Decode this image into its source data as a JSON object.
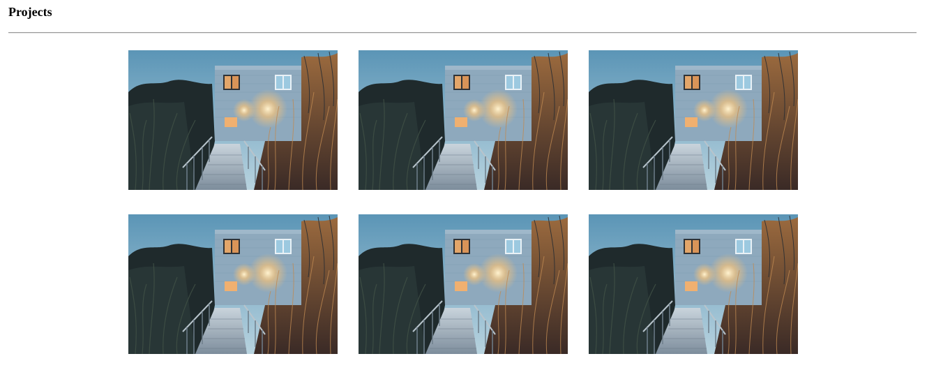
{
  "page": {
    "title": "Projects"
  },
  "projects": [
    {
      "photo": "house-at-dusk-photo"
    },
    {
      "photo": "house-at-dusk-photo"
    },
    {
      "photo": "house-at-dusk-photo"
    },
    {
      "photo": "house-at-dusk-photo"
    },
    {
      "photo": "house-at-dusk-photo"
    },
    {
      "photo": "house-at-dusk-photo"
    }
  ],
  "colors": {
    "sky_top": "#5b95b6",
    "sky_bottom": "#b8d3df",
    "house": "#8ea9bd",
    "foliage_dark": "#1f2a2c",
    "reeds_warm": "#8a5a35",
    "window_glow": "#f0b070",
    "walkway": "#a7b5c2",
    "rule": "#9a9a9a"
  }
}
